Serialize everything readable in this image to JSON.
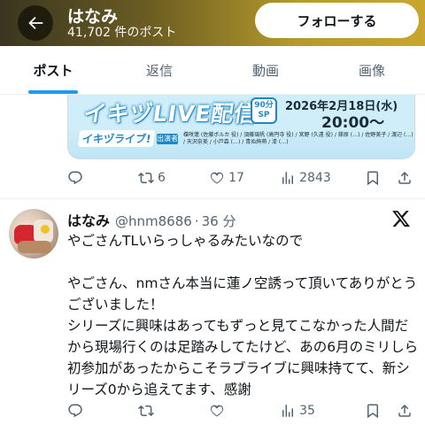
{
  "header": {
    "title": "はなみ",
    "subtitle": "41,702 件のポスト",
    "follow_label": "フォローする"
  },
  "tabs": [
    {
      "label": "ポスト",
      "active": true
    },
    {
      "label": "返信",
      "active": false
    },
    {
      "label": "動画",
      "active": false
    },
    {
      "label": "画像",
      "active": false
    }
  ],
  "banner": {
    "title": "イキヅLIVE配信",
    "badge": "90分\nSP",
    "date": "2026年2月18日(水)",
    "time": "20:00～",
    "logo": "イキヅライブ!",
    "tag": "出演者",
    "cast": "楪咲蓮 (佐藤ボルカ 役) / 須藤璃帆 (高円寺 役) / 宮野 (久遠 役) / 篠原 (…) / 佐野美子 / 渡辺 (…) / 天沢奈美 / 小戸森 (…) / 青ぬ絢萌 / 漆 (…)"
  },
  "first_post_actions": {
    "reply": "",
    "repost": "6",
    "like": "17",
    "views": "2843"
  },
  "tweet": {
    "name": "はなみ",
    "handle": "@hnm8686",
    "separator": "·",
    "time": "36 分",
    "body": "やごさんTLいらっしゃるみたいなので\n\nやごさん、nmさん本当に蓮ノ空誘って頂いてありがとうございました！\nシリーズに興味はあってもずっと見てこなかった人間だから現場行くのは足踏みしてたけど、あの6月のミリしら初参加があったからこそラブライブに興味持てて、新シリーズ0から追えてます、感謝",
    "actions": {
      "reply": "",
      "repost": "",
      "like": "",
      "views": "35"
    }
  },
  "colors": {
    "accent": "#1d9bf0",
    "muted": "#536471",
    "text": "#0f1419"
  },
  "icons": [
    "back-arrow-icon",
    "reply-icon",
    "repost-icon",
    "like-icon",
    "views-icon",
    "bookmark-icon",
    "share-icon",
    "x-logo-icon"
  ]
}
